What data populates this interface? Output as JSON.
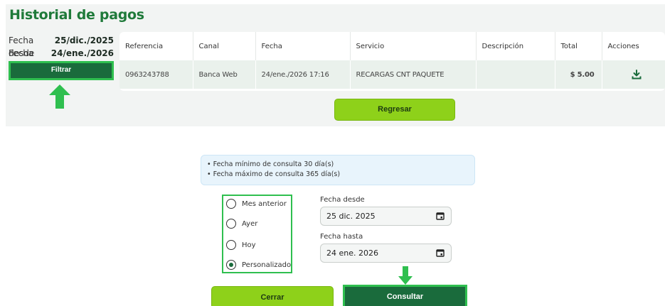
{
  "header": {
    "title": "Historial de pagos"
  },
  "filters_summary": {
    "desde_label": "Fecha desde",
    "desde_value": "25/dic./2025",
    "hasta_label": "Fecha hasta",
    "hasta_value": "24/ene./2026",
    "filtrar_label": "Filtrar"
  },
  "table": {
    "columns": [
      "Referencia",
      "Canal",
      "Fecha",
      "Servicio",
      "Descripción",
      "Total",
      "Acciones"
    ],
    "rows": [
      {
        "referencia": "0963243788",
        "canal": "Banca Web",
        "fecha": "24/ene./2026 17:16",
        "servicio": "RECARGAS CNT PAQUETE",
        "descripcion": "",
        "total": "$ 5.00",
        "accion_icon": "download-icon"
      }
    ]
  },
  "regresar_label": "Regresar",
  "modal": {
    "info": [
      "• Fecha mínimo de consulta 30 día(s)",
      "• Fecha máximo de consulta 365 día(s)"
    ],
    "options": [
      {
        "label": "Mes anterior",
        "checked": false
      },
      {
        "label": "Ayer",
        "checked": false
      },
      {
        "label": "Hoy",
        "checked": false
      },
      {
        "label": "Personalizado",
        "checked": true
      }
    ],
    "fecha_desde_label": "Fecha desde",
    "fecha_desde_value": "25 dic. 2025",
    "fecha_hasta_label": "Fecha hasta",
    "fecha_hasta_value": "24 ene. 2026",
    "cerrar_label": "Cerrar",
    "consultar_label": "Consultar"
  },
  "colors": {
    "title_green": "#1f7a3a",
    "dark_green": "#1a6b3c",
    "lime": "#8ed11a",
    "highlight_green": "#2fbf4f",
    "info_bg": "#e8f4fc"
  },
  "icons": {
    "annotation_arrow": "arrow-icon",
    "calendar": "calendar-icon",
    "download": "download-icon"
  }
}
